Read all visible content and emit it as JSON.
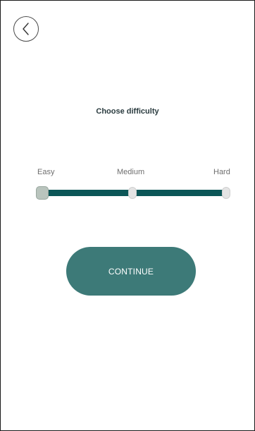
{
  "header": {
    "back_icon": "chevron-left-icon"
  },
  "main": {
    "title": "Choose difficulty",
    "difficulty": {
      "levels": [
        "Easy",
        "Medium",
        "Hard"
      ],
      "selected": "Easy",
      "selected_index": 0
    },
    "continue_label": "CONTINUE"
  },
  "colors": {
    "accent": "#3d7a78",
    "track": "#0c5657",
    "title_text": "#2a3b3f"
  }
}
